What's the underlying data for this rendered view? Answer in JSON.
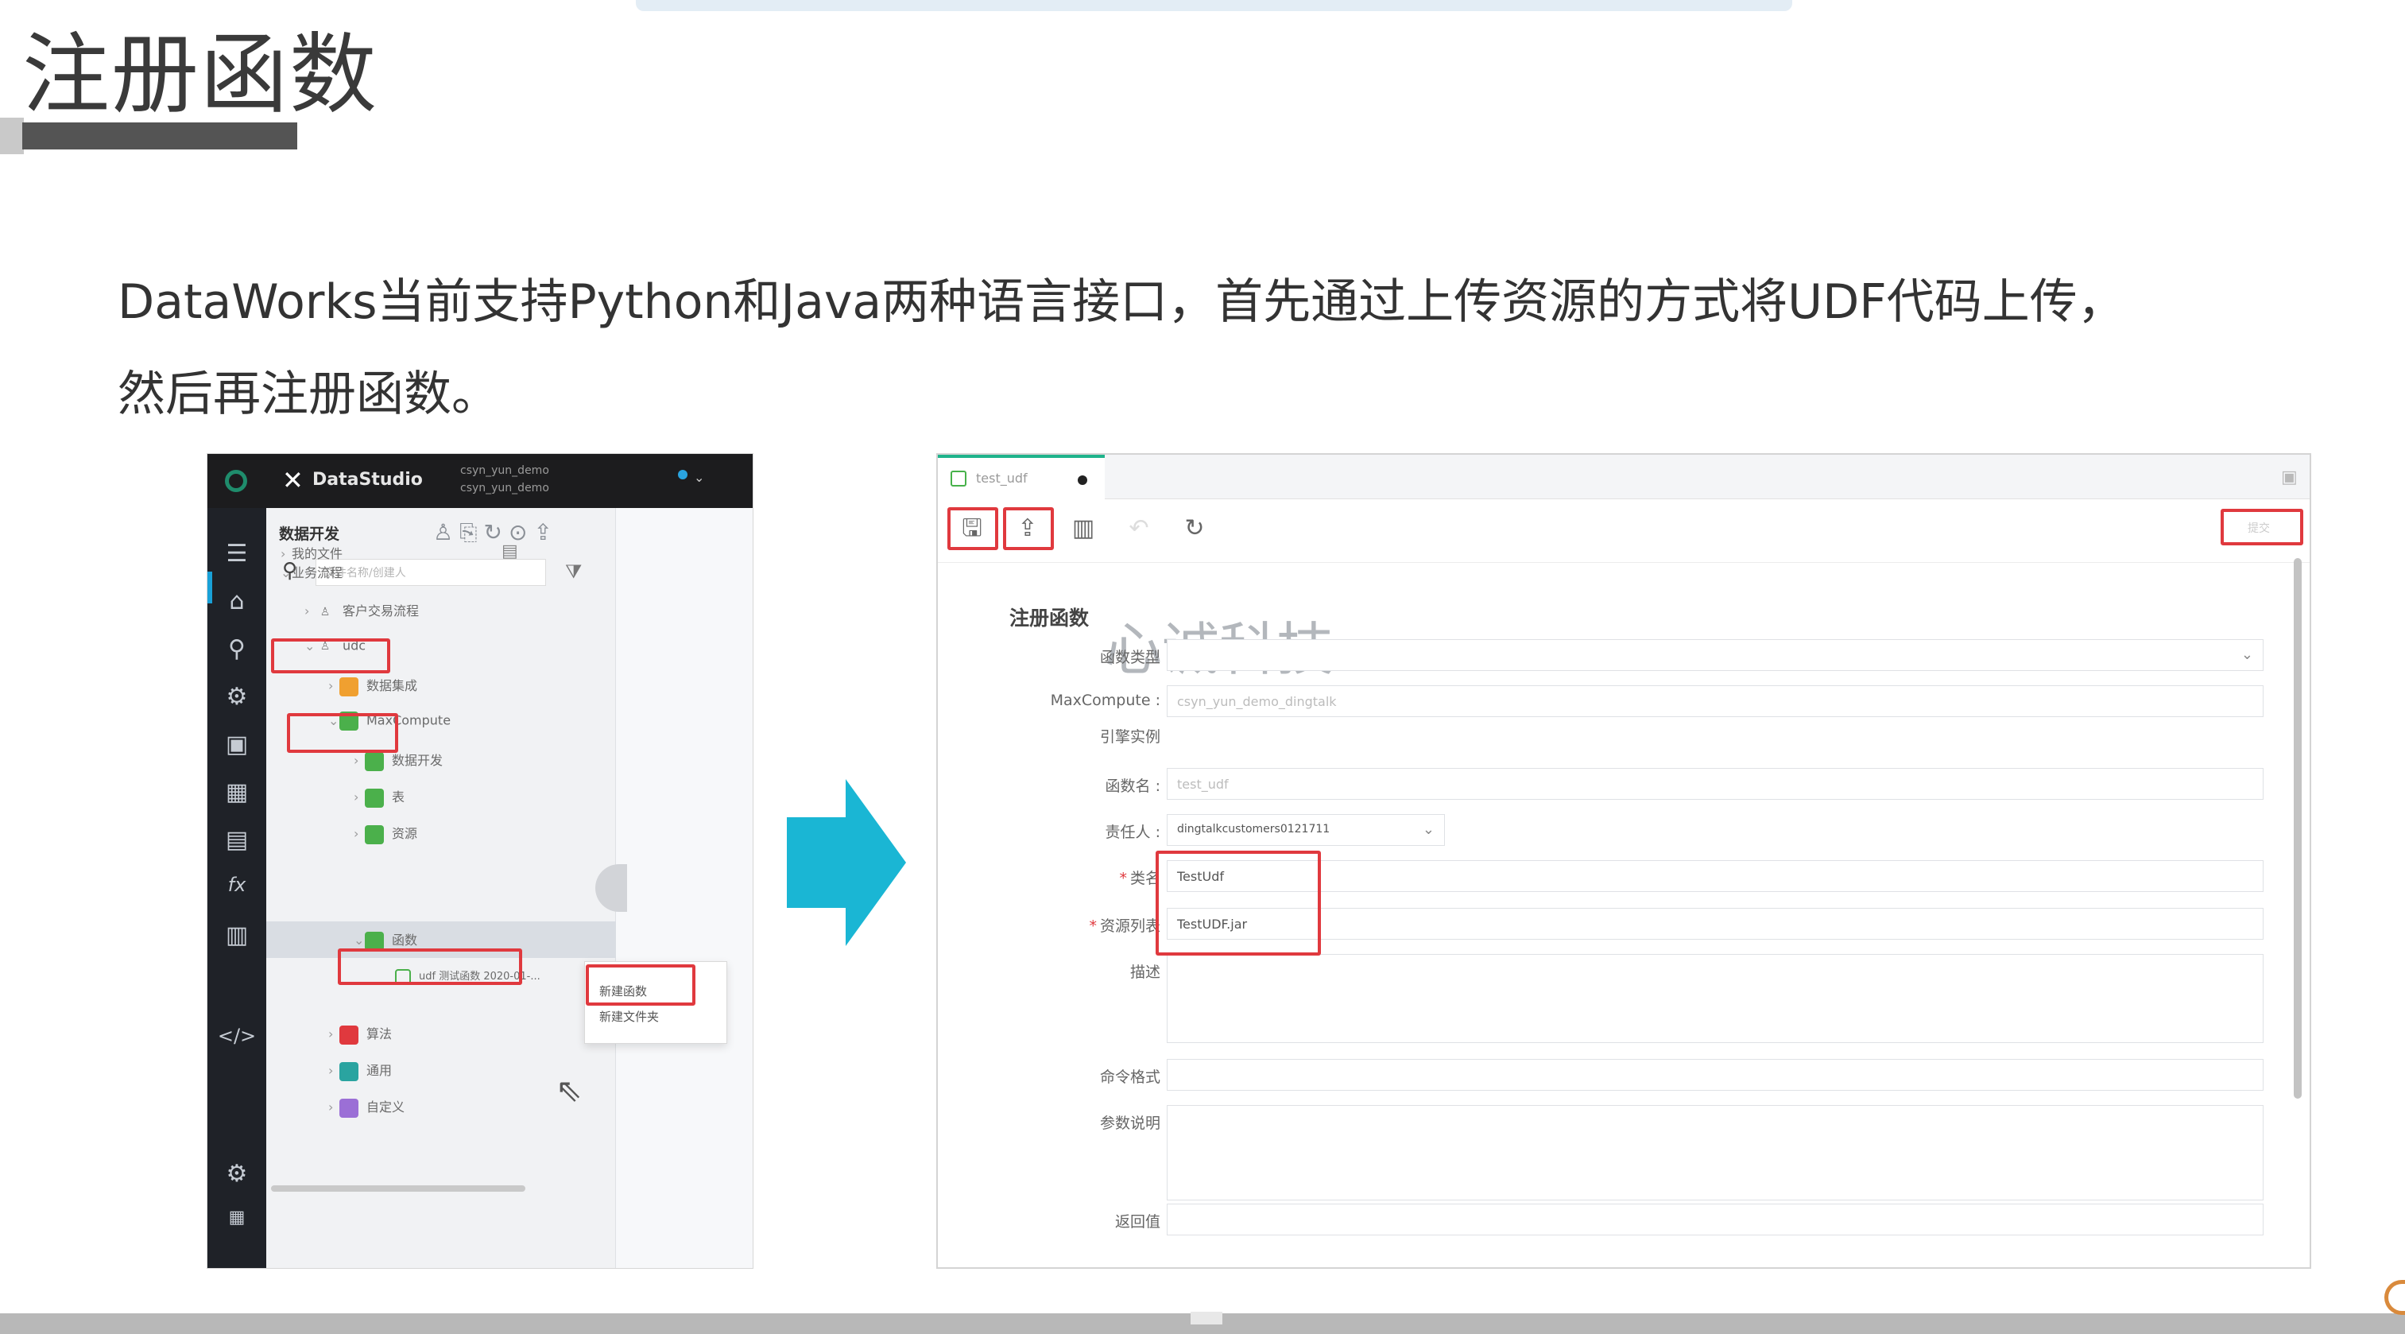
{
  "slide": {
    "title": "注册函数",
    "description_line1": "DataWorks当前支持Python和Java两种语言接口，首先通过上传资源的方式将UDF代码上传，",
    "description_line2": "然后再注册函数。"
  },
  "dataStudio": {
    "app_icon": "✕",
    "app_title": "DataStudio",
    "workspace_line1": "csyn_yun_demo",
    "workspace_line2": "csyn_yun_demo",
    "tree_header": "数据开发",
    "search_placeholder": "文件名称/创建人",
    "nav_icons": [
      "file-tree-icon",
      "home-icon",
      "search-icon",
      "settings-icon",
      "briefcase-icon",
      "calendar-icon",
      "table-icon",
      "function-icon",
      "trash-icon",
      "code-icon",
      "gear-icon",
      "grid-icon"
    ],
    "tree": [
      {
        "label": "我的文件",
        "color": ""
      },
      {
        "label": "业务流程",
        "color": ""
      },
      {
        "label": "客户交易流程",
        "color": ""
      },
      {
        "label": "udc",
        "color": ""
      },
      {
        "label": "数据集成",
        "color": "#f0a030"
      },
      {
        "label": "MaxCompute",
        "color": "#4bb04b"
      },
      {
        "label": "数据开发",
        "color": "#4bb04b"
      },
      {
        "label": "表",
        "color": "#4bb04b"
      },
      {
        "label": "资源",
        "color": "#4bb04b"
      },
      {
        "label": "函数",
        "color": "#4bb04b"
      },
      {
        "label": "udf  测试函数  2020-01-...",
        "color": "#4bb04b"
      },
      {
        "label": "算法",
        "color": "#e0393e"
      },
      {
        "label": "通用",
        "color": "#2aa4a0"
      },
      {
        "label": "自定义",
        "color": "#9b6fd6"
      }
    ],
    "context_menu": [
      "新建函数",
      "新建文件夹"
    ]
  },
  "register": {
    "tab_label": "test_udf",
    "top_right_button": "提交",
    "section_title": "注册函数",
    "watermark": "心诚科技",
    "fields": {
      "function_type_label": "函数类型",
      "maxcompute_label": "MaxCompute :",
      "maxcompute_value": "csyn_yun_demo_dingtalk",
      "engine_label": "引擎实例",
      "function_name_label": "函数名 :",
      "function_name_value": "test_udf",
      "owner_label": "责任人 :",
      "owner_value": "dingtalkcustomers0121711",
      "class_label": "类名",
      "class_value": "TestUdf",
      "resource_label": "资源列表",
      "resource_value": "TestUDF.jar",
      "description_label": "描述",
      "command_format_label": "命令格式",
      "param_desc_label": "参数说明",
      "return_value_label": "返回值"
    }
  },
  "colors": {
    "highlight_box": "#e0393e",
    "arrow": "#1ab6d4",
    "ds_topbar": "#1c1c1e",
    "ds_nav": "#1f2228",
    "accent_green": "#1fb38b"
  }
}
